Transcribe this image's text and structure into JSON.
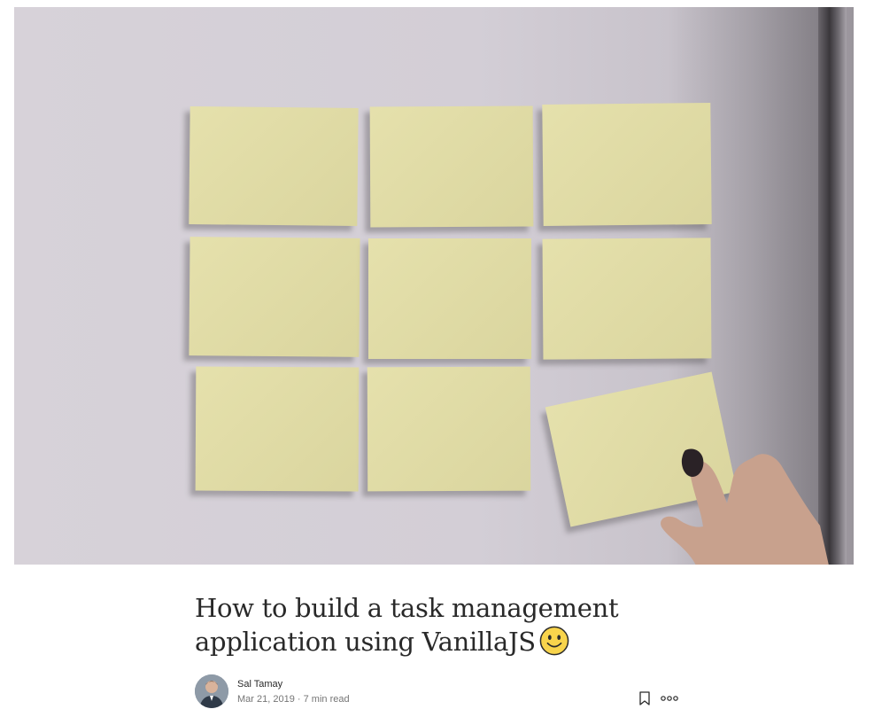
{
  "article": {
    "title": "How to build a task management application using VanillaJS",
    "emoji": "slightly-smiling-face-emoji"
  },
  "author": {
    "name": "Sal Tamay",
    "date": "Mar 21, 2019",
    "separator": "·",
    "read_time": "7 min read"
  },
  "actions": {
    "bookmark_icon": "bookmark-icon",
    "more_icon": "more-options-icon"
  },
  "hero": {
    "description_icon": "sticky-notes-photo",
    "note_color": "#e3dea5",
    "wall_color": "#d4cfd7"
  }
}
